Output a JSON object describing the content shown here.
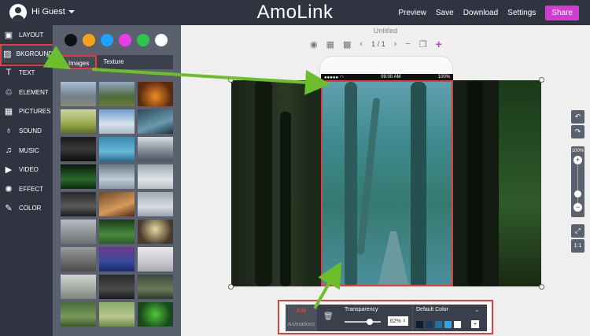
{
  "header": {
    "greeting": "Hi Guest",
    "brand": "AmoLink",
    "nav": [
      "Preview",
      "Save",
      "Download",
      "Settings"
    ],
    "share_label": "Share"
  },
  "sidebar": {
    "items": [
      {
        "label": "LAYOUT",
        "icon": "layout-icon"
      },
      {
        "label": "BKGROUND",
        "icon": "background-image-icon"
      },
      {
        "label": "TEXT",
        "icon": "text-icon"
      },
      {
        "label": "ELEMENT",
        "icon": "element-icon"
      },
      {
        "label": "PICTURES",
        "icon": "pictures-icon"
      },
      {
        "label": "SOUND",
        "icon": "microphone-icon"
      },
      {
        "label": "MUSIC",
        "icon": "music-note-icon"
      },
      {
        "label": "VIDEO",
        "icon": "video-icon"
      },
      {
        "label": "EFFECT",
        "icon": "effect-icon"
      },
      {
        "label": "COLOR",
        "icon": "paint-brush-icon"
      }
    ]
  },
  "panel": {
    "swatch_colors": [
      "#111111",
      "#f7a21b",
      "#1aa3ff",
      "#e83de8",
      "#2dc64a",
      "#ffffff"
    ],
    "tabs": [
      "Images",
      "Texture"
    ]
  },
  "canvas": {
    "doc_title": "Untitled",
    "pager": "1 / 1",
    "status_time": "09:00 AM",
    "status_battery": "100%"
  },
  "zoom": {
    "level": "100%",
    "fit_label": "1:1"
  },
  "properties": {
    "edit_tab": "Edit",
    "animations_tab": "Animations",
    "transparency_label": "Transparency",
    "transparency_value": "62%",
    "default_color_label": "Default Color",
    "color_chips": [
      "#0d1b2a",
      "#1b3a5c",
      "#1f6fa8",
      "#2ea7e6",
      "#ffffff"
    ],
    "add_label": "+"
  },
  "colors": {
    "topbar": "#2f3440",
    "accent": "#d43bd4",
    "highlight": "#e03d3d",
    "arrow": "#6cbf2a"
  }
}
